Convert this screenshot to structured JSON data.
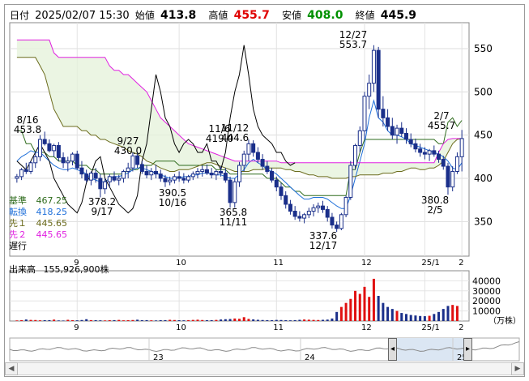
{
  "header": {
    "date_label": "日付",
    "datetime": "2025/02/07 15:30",
    "open_label": "始値",
    "open": "413.8",
    "high_label": "高値",
    "high": "455.7",
    "low_label": "安値",
    "low": "408.0",
    "close_label": "終値",
    "close": "445.9"
  },
  "legend": [
    {
      "label": "基準",
      "value": "467.25",
      "color": "#2e6b1c"
    },
    {
      "label": "転換",
      "value": "418.25",
      "color": "#1e6fd9"
    },
    {
      "label": "先１",
      "value": "445.65",
      "color": "#6b6b1c"
    },
    {
      "label": "先２",
      "value": "445.65",
      "color": "#e020e0"
    },
    {
      "label": "遅行",
      "value": "",
      "color": "#000000"
    }
  ],
  "annotations": [
    {
      "id": "a1",
      "line1": "8/16",
      "line2": "453.8"
    },
    {
      "id": "a2",
      "line1": "9/27",
      "line2": "430.0"
    },
    {
      "id": "a3",
      "line1": "378.2",
      "line2": "9/17"
    },
    {
      "id": "a4",
      "line1": "390.5",
      "line2": "10/16"
    },
    {
      "id": "a5",
      "line1": "11/6",
      "line2": "419.0"
    },
    {
      "id": "a6",
      "line1": "11/12",
      "line2": "444.6"
    },
    {
      "id": "a7",
      "line1": "365.8",
      "line2": "11/11"
    },
    {
      "id": "a8",
      "line1": "12/27",
      "line2": "553.7"
    },
    {
      "id": "a9",
      "line1": "337.6",
      "line2": "12/17"
    },
    {
      "id": "a10",
      "line1": "2/7",
      "line2": "455.7"
    },
    {
      "id": "a11",
      "line1": "380.8",
      "line2": "2/5"
    }
  ],
  "volume": {
    "title": "出来高",
    "total": "155,926,900株",
    "unit": "（万株）",
    "yticks": [
      "40000",
      "30000",
      "20000",
      "10000"
    ]
  },
  "navigator": {
    "labels": [
      "23",
      "24",
      "25"
    ]
  },
  "chart_data": {
    "type": "candlestick",
    "ylim": [
      310,
      580
    ],
    "yticks": [
      350,
      400,
      450,
      500,
      550
    ],
    "xticks": [
      "9",
      "10",
      "11",
      "12",
      "25/1",
      "2"
    ],
    "candles": [
      [
        400,
        405,
        395,
        402
      ],
      [
        402,
        412,
        398,
        410
      ],
      [
        410,
        418,
        405,
        408
      ],
      [
        408,
        420,
        405,
        418
      ],
      [
        418,
        430,
        412,
        425
      ],
      [
        425,
        450,
        420,
        445
      ],
      [
        445,
        454,
        438,
        440
      ],
      [
        440,
        445,
        430,
        432
      ],
      [
        432,
        440,
        425,
        438
      ],
      [
        438,
        442,
        420,
        424
      ],
      [
        424,
        430,
        412,
        418
      ],
      [
        418,
        425,
        408,
        420
      ],
      [
        420,
        430,
        415,
        428
      ],
      [
        428,
        432,
        410,
        412
      ],
      [
        412,
        420,
        400,
        405
      ],
      [
        405,
        410,
        395,
        398
      ],
      [
        398,
        408,
        392,
        406
      ],
      [
        406,
        412,
        395,
        400
      ],
      [
        400,
        405,
        378,
        388
      ],
      [
        388,
        400,
        382,
        396
      ],
      [
        396,
        405,
        390,
        402
      ],
      [
        402,
        408,
        396,
        398
      ],
      [
        398,
        404,
        392,
        400
      ],
      [
        400,
        410,
        395,
        408
      ],
      [
        408,
        418,
        400,
        412
      ],
      [
        412,
        430,
        408,
        426
      ],
      [
        426,
        430,
        412,
        416
      ],
      [
        416,
        420,
        405,
        408
      ],
      [
        408,
        415,
        400,
        404
      ],
      [
        404,
        412,
        398,
        408
      ],
      [
        408,
        416,
        400,
        405
      ],
      [
        405,
        410,
        396,
        400
      ],
      [
        400,
        404,
        390,
        396
      ],
      [
        396,
        402,
        392,
        398
      ],
      [
        398,
        405,
        394,
        402
      ],
      [
        402,
        408,
        396,
        400
      ],
      [
        400,
        406,
        394,
        398
      ],
      [
        398,
        404,
        395,
        402
      ],
      [
        402,
        408,
        398,
        405
      ],
      [
        405,
        412,
        400,
        408
      ],
      [
        408,
        415,
        402,
        410
      ],
      [
        410,
        416,
        404,
        406
      ],
      [
        406,
        412,
        400,
        404
      ],
      [
        404,
        410,
        398,
        408
      ],
      [
        408,
        414,
        402,
        406
      ],
      [
        406,
        412,
        395,
        398
      ],
      [
        398,
        402,
        366,
        372
      ],
      [
        372,
        400,
        366,
        396
      ],
      [
        396,
        419,
        390,
        415
      ],
      [
        415,
        432,
        408,
        428
      ],
      [
        428,
        445,
        420,
        440
      ],
      [
        440,
        444,
        425,
        430
      ],
      [
        430,
        436,
        418,
        422
      ],
      [
        422,
        428,
        410,
        414
      ],
      [
        414,
        420,
        405,
        408
      ],
      [
        408,
        412,
        395,
        398
      ],
      [
        398,
        402,
        385,
        390
      ],
      [
        390,
        395,
        375,
        380
      ],
      [
        380,
        385,
        365,
        370
      ],
      [
        370,
        375,
        358,
        362
      ],
      [
        362,
        368,
        352,
        356
      ],
      [
        356,
        362,
        350,
        354
      ],
      [
        354,
        360,
        348,
        358
      ],
      [
        358,
        366,
        354,
        362
      ],
      [
        362,
        370,
        356,
        366
      ],
      [
        366,
        372,
        360,
        368
      ],
      [
        368,
        374,
        360,
        364
      ],
      [
        364,
        368,
        350,
        355
      ],
      [
        355,
        360,
        342,
        346
      ],
      [
        346,
        350,
        338,
        342
      ],
      [
        342,
        360,
        340,
        358
      ],
      [
        358,
        380,
        355,
        378
      ],
      [
        378,
        420,
        375,
        415
      ],
      [
        415,
        440,
        410,
        438
      ],
      [
        438,
        460,
        430,
        455
      ],
      [
        455,
        500,
        445,
        495
      ],
      [
        495,
        520,
        480,
        510
      ],
      [
        510,
        554,
        500,
        548
      ],
      [
        548,
        552,
        470,
        480
      ],
      [
        480,
        495,
        460,
        470
      ],
      [
        470,
        480,
        455,
        460
      ],
      [
        460,
        470,
        445,
        450
      ],
      [
        450,
        462,
        440,
        458
      ],
      [
        458,
        465,
        448,
        452
      ],
      [
        452,
        458,
        440,
        445
      ],
      [
        445,
        452,
        436,
        440
      ],
      [
        440,
        446,
        430,
        434
      ],
      [
        434,
        440,
        425,
        430
      ],
      [
        430,
        436,
        422,
        428
      ],
      [
        428,
        434,
        420,
        432
      ],
      [
        432,
        438,
        425,
        428
      ],
      [
        428,
        432,
        418,
        422
      ],
      [
        422,
        426,
        410,
        414
      ],
      [
        414,
        418,
        381,
        390
      ],
      [
        390,
        414,
        385,
        408
      ],
      [
        408,
        430,
        405,
        425
      ],
      [
        425,
        456,
        408,
        446
      ]
    ],
    "series": [
      {
        "name": "基準",
        "color": "#2e6b1c",
        "values": [
          455,
          455,
          440,
          440,
          430,
          430,
          430,
          425,
          425,
          420,
          420,
          420,
          420,
          415,
          415,
          415,
          410,
          410,
          405,
          405,
          405,
          405,
          405,
          405,
          410,
          410,
          410,
          415,
          415,
          415,
          420,
          420,
          420,
          420,
          420,
          415,
          415,
          415,
          415,
          415,
          415,
          415,
          415,
          410,
          410,
          410,
          405,
          405,
          405,
          405,
          405,
          405,
          405,
          405,
          400,
          400,
          400,
          395,
          390,
          390,
          385,
          385,
          380,
          380,
          380,
          380,
          380,
          380,
          380,
          380,
          380,
          380,
          410,
          410,
          430,
          445,
          445,
          445,
          445,
          445,
          445,
          445,
          445,
          445,
          445,
          445,
          445,
          445,
          445,
          445,
          445,
          440,
          440,
          465,
          470,
          460,
          467
        ]
      },
      {
        "name": "転換",
        "color": "#1e6fd9",
        "values": [
          420,
          425,
          428,
          432,
          430,
          430,
          425,
          420,
          415,
          412,
          410,
          410,
          412,
          410,
          408,
          405,
          400,
          398,
          396,
          396,
          400,
          402,
          402,
          404,
          406,
          410,
          412,
          412,
          410,
          408,
          406,
          404,
          402,
          400,
          400,
          400,
          402,
          402,
          404,
          404,
          406,
          406,
          406,
          404,
          404,
          402,
          400,
          400,
          405,
          410,
          418,
          422,
          418,
          415,
          410,
          408,
          405,
          400,
          395,
          390,
          385,
          380,
          376,
          376,
          378,
          378,
          378,
          376,
          372,
          368,
          365,
          365,
          380,
          400,
          420,
          440,
          470,
          490,
          470,
          465,
          455,
          450,
          450,
          448,
          445,
          440,
          438,
          436,
          434,
          432,
          430,
          428,
          425,
          420,
          412,
          410,
          418
        ]
      },
      {
        "name": "先１",
        "color": "#6b6b1c",
        "values": [
          540,
          540,
          540,
          540,
          540,
          530,
          520,
          500,
          480,
          470,
          460,
          460,
          460,
          460,
          455,
          455,
          450,
          450,
          445,
          445,
          442,
          440,
          438,
          436,
          432,
          430,
          428,
          425,
          420,
          418,
          415,
          412,
          410,
          408,
          408,
          410,
          410,
          410,
          412,
          414,
          416,
          418,
          418,
          416,
          414,
          412,
          410,
          408,
          408,
          408,
          408,
          410,
          410,
          410,
          412,
          412,
          412,
          412,
          410,
          410,
          408,
          408,
          406,
          404,
          404,
          402,
          402,
          402,
          400,
          400,
          400,
          400,
          402,
          402,
          404,
          404,
          404,
          404,
          404,
          406,
          406,
          406,
          408,
          408,
          410,
          412,
          412,
          410,
          410,
          412,
          412,
          415,
          420,
          430,
          440,
          445,
          446
        ]
      },
      {
        "name": "先２",
        "color": "#e020e0",
        "values": [
          560,
          560,
          560,
          560,
          560,
          560,
          560,
          560,
          545,
          540,
          540,
          540,
          540,
          540,
          540,
          540,
          540,
          540,
          540,
          540,
          530,
          525,
          525,
          520,
          520,
          515,
          510,
          505,
          500,
          490,
          480,
          470,
          465,
          460,
          455,
          450,
          445,
          440,
          438,
          436,
          434,
          432,
          430,
          428,
          426,
          424,
          422,
          420,
          420,
          420,
          420,
          420,
          420,
          420,
          420,
          420,
          420,
          418,
          418,
          418,
          418,
          418,
          418,
          418,
          418,
          418,
          418,
          418,
          418,
          418,
          418,
          418,
          418,
          418,
          418,
          418,
          418,
          418,
          418,
          418,
          418,
          418,
          418,
          418,
          418,
          418,
          418,
          418,
          418,
          418,
          418,
          430,
          440,
          445,
          446,
          446,
          446
        ]
      },
      {
        "name": "遅行",
        "color": "#000000",
        "values": [
          420,
          415,
          410,
          420,
          430,
          440,
          430,
          420,
          400,
          390,
          380,
          370,
          365,
          360,
          372,
          395,
          405,
          420,
          425,
          400,
          390,
          380,
          370,
          365,
          360,
          365,
          380,
          420,
          440,
          480,
          520,
          500,
          470,
          460,
          440,
          430,
          440,
          445,
          440,
          430,
          430,
          440,
          420,
          420,
          410,
          430,
          470,
          500,
          520,
          554,
          520,
          480,
          460,
          450,
          445,
          440,
          430,
          430,
          420,
          415,
          418
        ]
      }
    ],
    "volume_values": [
      600,
      900,
      1500,
      1100,
      1000,
      700,
      800,
      900,
      1400,
      600,
      500,
      1200,
      800,
      700,
      1000,
      1800,
      900,
      800,
      700,
      600,
      800,
      900,
      1100,
      700,
      800,
      1000,
      1300,
      800,
      900,
      700,
      600,
      800,
      900,
      1200,
      1000,
      800,
      700,
      900,
      1100,
      1300,
      1000,
      800,
      900,
      1100,
      1500,
      1800,
      2000,
      2500,
      2200,
      3800,
      2100,
      1600,
      1200,
      1000,
      900,
      800,
      1100,
      1000,
      800,
      700,
      900,
      1200,
      1500,
      1300,
      1100,
      1000,
      1200,
      1400,
      2500,
      9000,
      14000,
      18000,
      22000,
      30000,
      27000,
      34000,
      24000,
      42000,
      25000,
      18000,
      14000,
      12000,
      10000,
      8000,
      7000,
      6000,
      5500,
      5000,
      4800,
      5200,
      7000,
      9000,
      12000,
      15000,
      16000,
      15000
    ]
  }
}
